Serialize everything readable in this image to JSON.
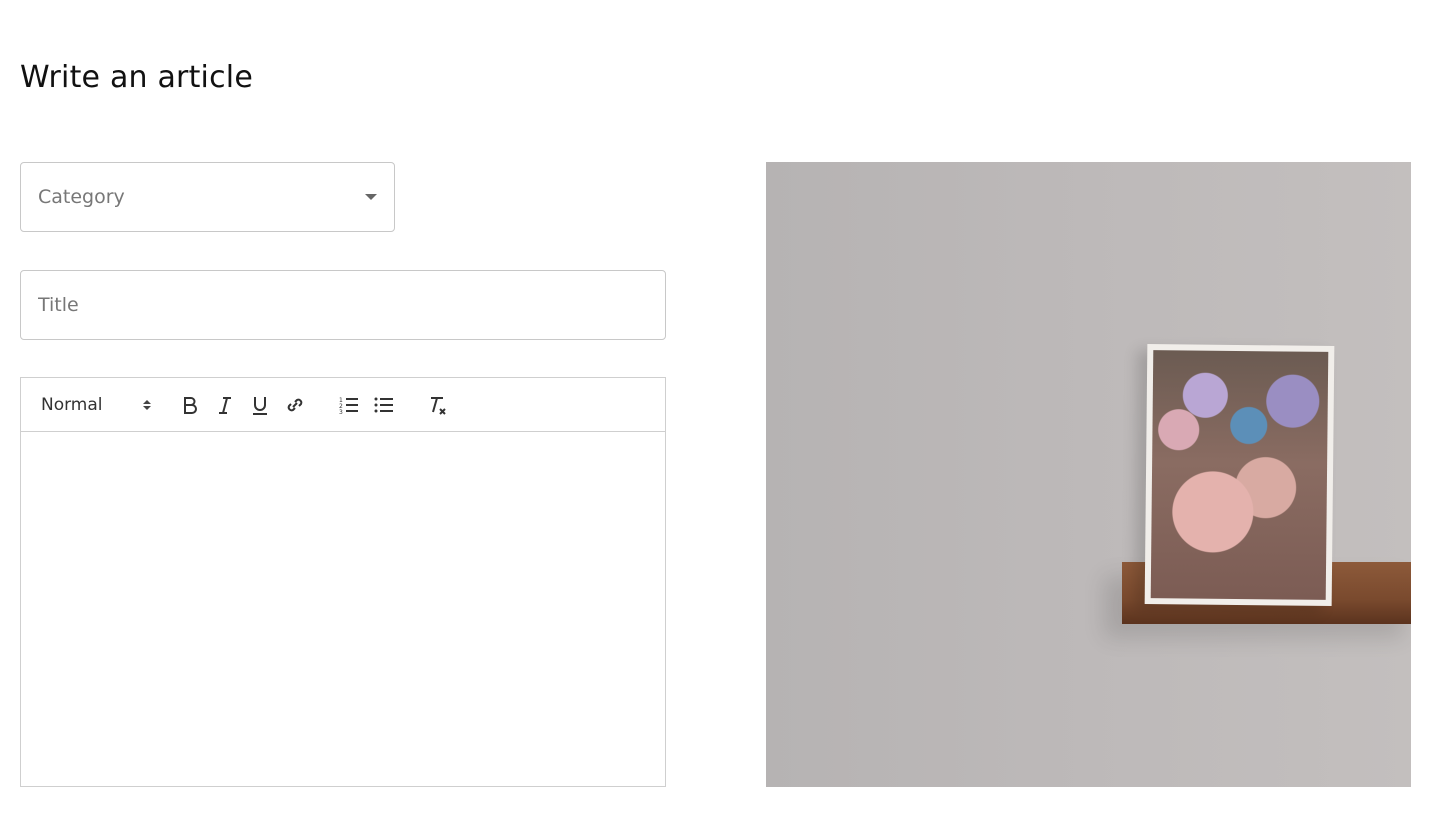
{
  "page": {
    "title": "Write an article"
  },
  "category_select": {
    "selected": "Category"
  },
  "title_input": {
    "placeholder": "Title",
    "value": ""
  },
  "editor": {
    "heading_picker": "Normal",
    "toolbar": [
      "bold-icon",
      "italic-icon",
      "underline-icon",
      "link-icon",
      "ordered-list-icon",
      "bullet-list-icon",
      "clear-format-icon"
    ]
  },
  "hero_image": {
    "alt": ""
  }
}
